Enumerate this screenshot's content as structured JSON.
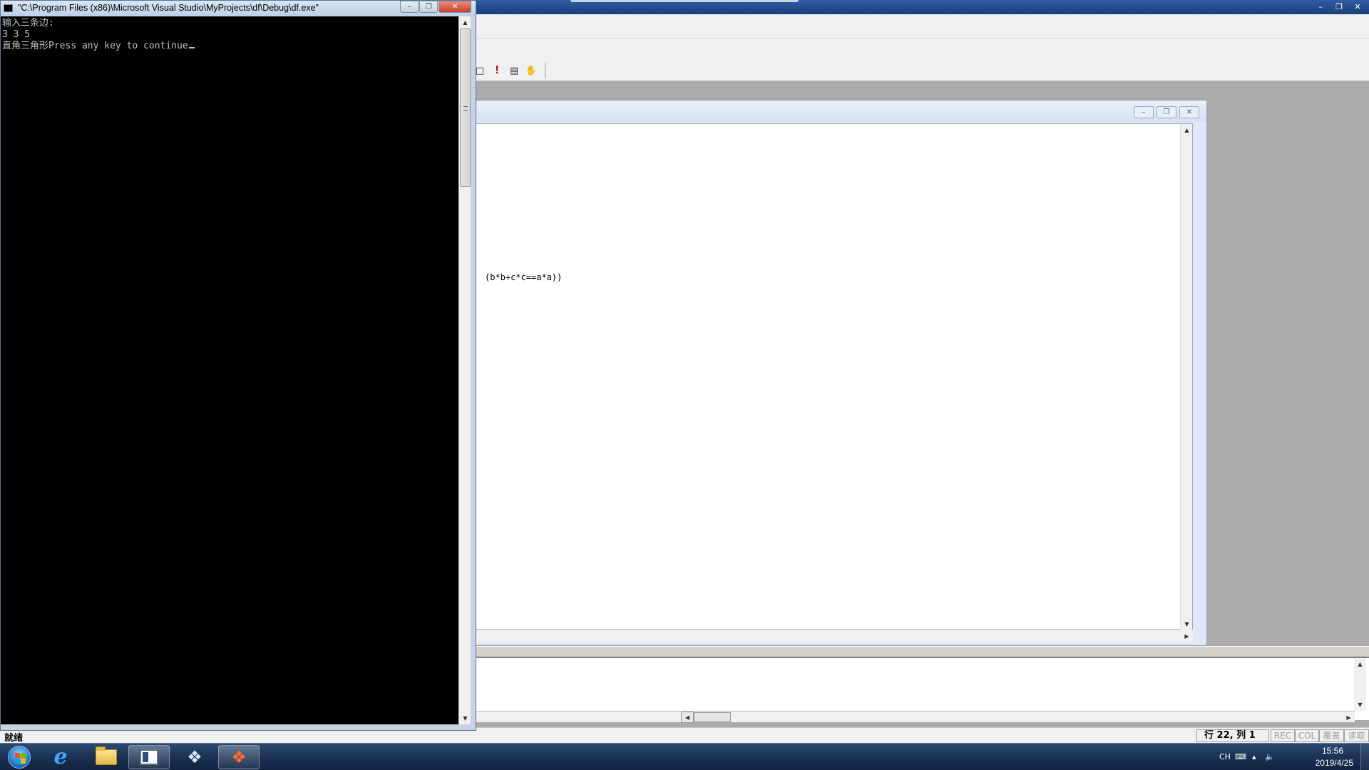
{
  "console": {
    "title": "\"C:\\Program Files (x86)\\Microsoft Visual Studio\\MyProjects\\df\\Debug\\df.exe\"",
    "lines": [
      "输入三条边:",
      "3 3 5",
      "直角三角形Press any key to continue"
    ]
  },
  "editor": {
    "code_line": "(b*b+c*c==a*a))"
  },
  "statusbar": {
    "status": "就绪",
    "position": "行 22, 列 1",
    "indicators": [
      "REC",
      "COL",
      "覆盖",
      "读取"
    ]
  },
  "tray": {
    "lang": "CH",
    "time": "15:56",
    "date": "2019/4/25"
  },
  "icons": {
    "window_min": "minimize-icon",
    "window_max": "maximize-icon",
    "window_close": "close-icon"
  }
}
